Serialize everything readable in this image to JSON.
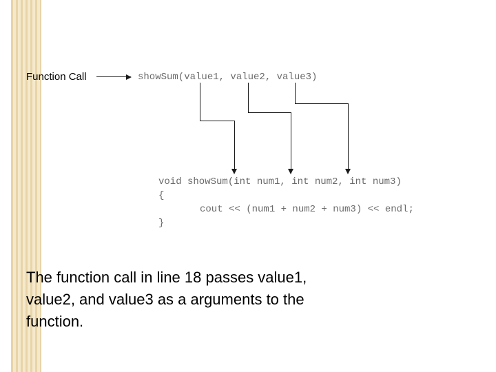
{
  "diagram": {
    "label": "Function Call",
    "call_code": "showSum(value1, value2, value3)",
    "def_sig": "void showSum(int num1, int num2, int num3)",
    "def_open": "{",
    "def_body": "cout << (num1 + num2 + num3) << endl;",
    "def_close": "}"
  },
  "explanation": {
    "line1": "The function call in line 18 passes value1,",
    "line2": "value2, and value3 as a arguments to the",
    "line3": "function."
  }
}
